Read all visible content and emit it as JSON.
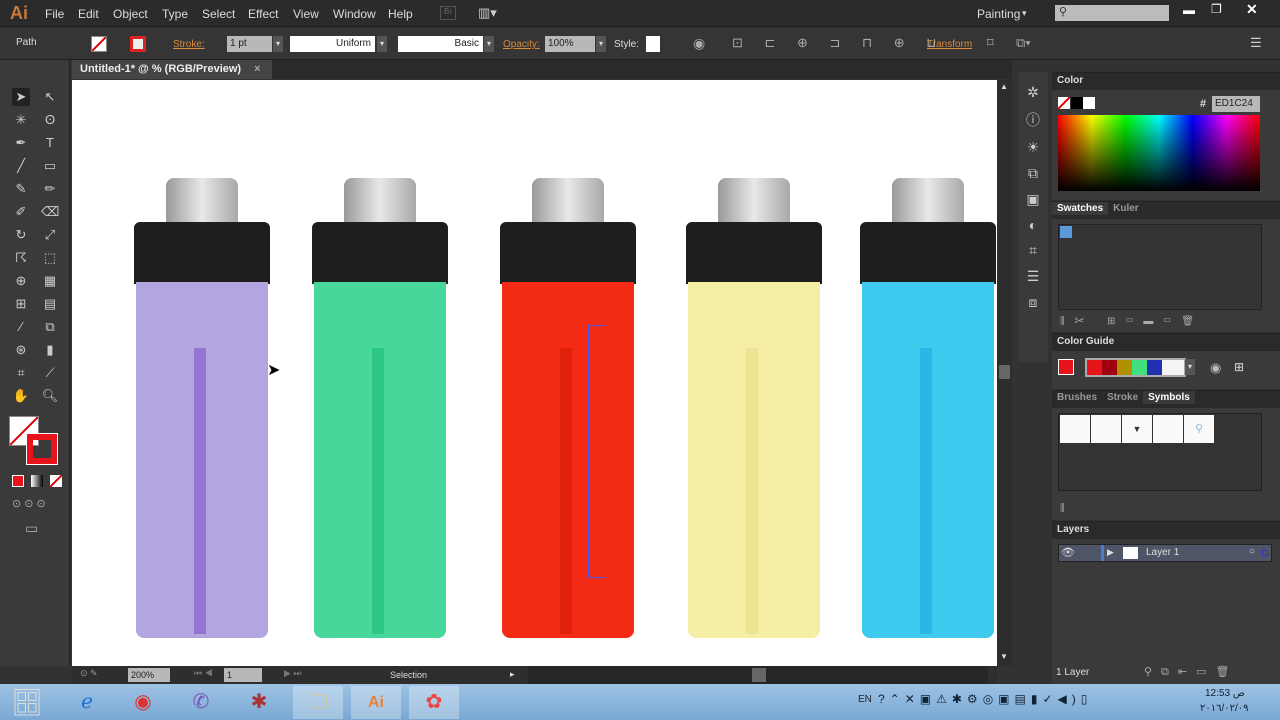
{
  "app": {
    "logo": "Ai",
    "menus": [
      "File",
      "Edit",
      "Object",
      "Type",
      "Select",
      "Effect",
      "View",
      "Window",
      "Help"
    ],
    "bridge": "Br",
    "workspace": "Painting",
    "search_placeholder": ""
  },
  "control": {
    "selection_type": "Path",
    "stroke_label": "Stroke:",
    "stroke_weight": "1 pt",
    "profile": "Uniform",
    "brush": "Basic",
    "opacity_label": "Opacity:",
    "opacity": "100%",
    "style_label": "Style:",
    "transform": "Transform"
  },
  "document": {
    "tab_title": "Untitled-1* @ % (RGB/Preview)",
    "close": "×"
  },
  "status": {
    "zoom": "200%",
    "artboard": "1",
    "tool": "Selection"
  },
  "color_panel": {
    "title": "Color",
    "hex_label": "#",
    "hex": "ED1C24"
  },
  "swatches_panel": {
    "tabs": [
      "Swatches",
      "Kuler"
    ]
  },
  "color_guide": {
    "title": "Color Guide",
    "harmony": [
      "#e8141c",
      "#a00010",
      "#b09000",
      "#40e080",
      "#2030b0",
      "#f4f4f4"
    ]
  },
  "symbols_panel": {
    "tabs": [
      "Brushes",
      "Stroke",
      "Symbols"
    ]
  },
  "layers": {
    "title": "Layers",
    "items": [
      {
        "name": "Layer 1"
      }
    ],
    "count": "1 Layer"
  },
  "artwork": {
    "lighters": [
      {
        "color": "#b3a5de",
        "tube": "#7a4fc8"
      },
      {
        "color": "#47d79a",
        "tube": "#18b870"
      },
      {
        "color": "#f32a14",
        "tube": "#d01808"
      },
      {
        "color": "#f7eea6",
        "tube": "#e8dc80"
      },
      {
        "color": "#3ec9ef",
        "tube": "#18a8e0"
      }
    ]
  },
  "taskbar": {
    "lang": "EN",
    "time": "12:53 ص",
    "date": "٢٠١٦/٠٢/٠٩"
  }
}
